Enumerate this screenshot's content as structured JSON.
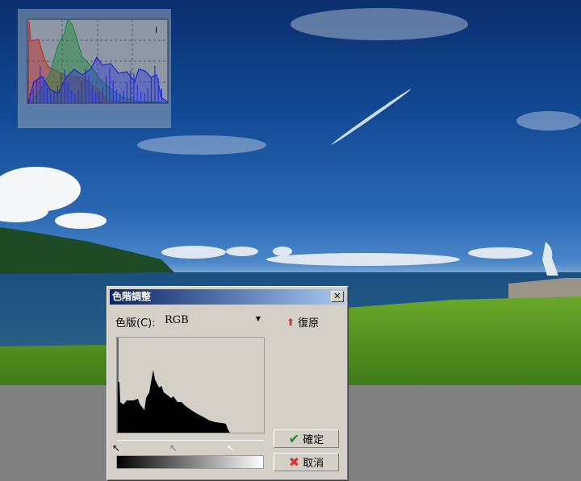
{
  "dialog": {
    "title": "色階調整",
    "close": "✕",
    "channel_label": "色版(C):",
    "channel_value": "RGB",
    "reset_label": "復原",
    "ok_label": "確定",
    "cancel_label": "取消"
  },
  "overlay": {
    "cursor_glyph": "I"
  },
  "colors": {
    "title_start": "#0a246a",
    "title_end": "#a6caf0",
    "dialog_bg": "#d4d0c8"
  }
}
